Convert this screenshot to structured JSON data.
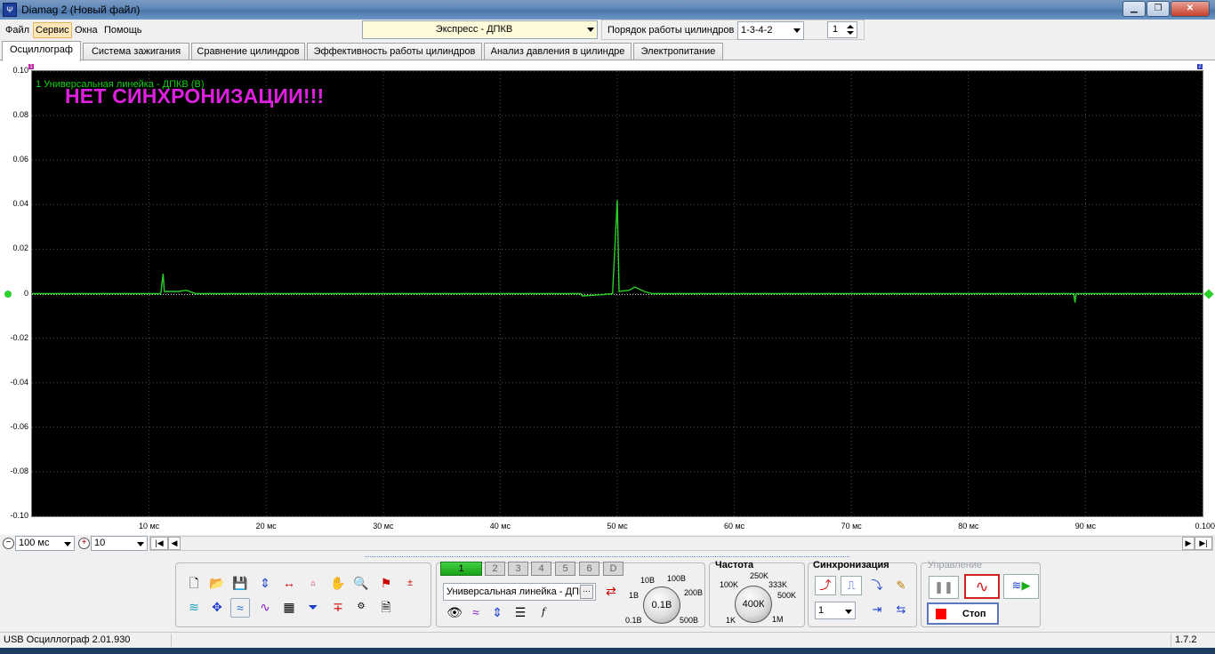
{
  "window": {
    "title": "Diamag 2 (Новый файл)",
    "app_icon_glyph": "Ψ",
    "buttons": {
      "minimize": "▁",
      "maximize": "❐",
      "close": "✕"
    }
  },
  "menu": {
    "items": [
      "Файл",
      "Сервис",
      "Окна",
      "Помощь"
    ],
    "active": "Сервис"
  },
  "toolbar": {
    "mode_select": "Экспресс - ДПКВ",
    "cylinder_order_label": "Порядок работы цилиндров",
    "cylinder_order_value": "1-3-4-2",
    "cylinder_number": "1"
  },
  "tabs": [
    {
      "label": "Осциллограф",
      "active": true
    },
    {
      "label": "Система зажигания",
      "active": false
    },
    {
      "label": "Сравнение цилиндров",
      "active": false
    },
    {
      "label": "Эффективность работы цилиндров",
      "active": false
    },
    {
      "label": "Анализ давления в цилиндре",
      "active": false
    },
    {
      "label": "Электропитание",
      "active": false
    }
  ],
  "scope": {
    "series_label": "1 Универсальная линейка - ДПКВ (В)",
    "warning": "НЕТ СИНХРОНИЗАЦИИ!!!",
    "marker_left": "1",
    "marker_right": "2"
  },
  "chart_data": {
    "type": "line",
    "ylim": [
      -0.1,
      0.1
    ],
    "xlim": [
      0,
      100
    ],
    "y_ticks": [
      "0.10",
      "0.08",
      "0.06",
      "0.04",
      "0.02",
      "0",
      "-0.02",
      "-0.04",
      "-0.06",
      "-0.08",
      "-0.10"
    ],
    "x_ticks": [
      "10 мс",
      "20 мс",
      "30 мс",
      "40 мс",
      "50 мс",
      "60 мс",
      "70 мс",
      "80 мс",
      "90 мс",
      "0.100"
    ],
    "grid": true,
    "line_color": "#2bd12b",
    "series": [
      {
        "name": "1 Универсальная линейка - ДПКВ (В)",
        "points": [
          [
            0,
            0.0
          ],
          [
            11.0,
            0.0
          ],
          [
            11.2,
            0.009
          ],
          [
            11.3,
            0.001
          ],
          [
            12.5,
            0.001
          ],
          [
            13.2,
            0.0015
          ],
          [
            14,
            0.0
          ],
          [
            46.9,
            0.0
          ],
          [
            47.0,
            -0.001
          ],
          [
            48.5,
            -0.0005
          ],
          [
            49.6,
            0.0
          ],
          [
            50.0,
            0.042
          ],
          [
            50.15,
            0.001
          ],
          [
            51.0,
            0.0015
          ],
          [
            51.5,
            0.003
          ],
          [
            52.3,
            0.001
          ],
          [
            53,
            0.0
          ],
          [
            89.0,
            0.0
          ],
          [
            89.1,
            -0.004
          ],
          [
            89.2,
            0.0
          ],
          [
            100,
            0.0
          ]
        ]
      }
    ]
  },
  "timebase": {
    "time_per_div": "100 мс",
    "zoom": "10"
  },
  "channels": [
    "1",
    "2",
    "3",
    "4",
    "5",
    "6",
    "D"
  ],
  "channel_active": "1",
  "channel_source": "Универсальная линейка - ДПКВ (В)",
  "channel_source_more": "···",
  "voltage": {
    "knob_value": "0.1В",
    "labels": [
      "10В",
      "100В",
      "1В",
      "200В",
      "0.1В",
      "500В"
    ]
  },
  "frequency": {
    "title": "Частота",
    "knob_value": "400К",
    "labels": [
      "250K",
      "100K",
      "333K",
      "500K",
      "1K",
      "1M"
    ]
  },
  "sync": {
    "title": "Синхронизация",
    "channel": "1"
  },
  "control": {
    "title": "Управление",
    "stop_label": "Стоп"
  },
  "status": {
    "device": "USB Осциллограф  2.01.930",
    "version": "1.7.2"
  }
}
